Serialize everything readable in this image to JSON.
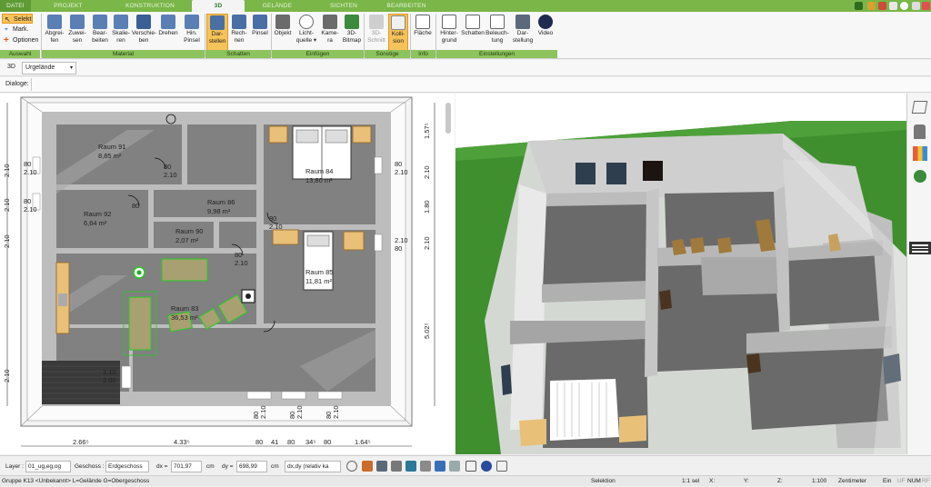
{
  "tabs": [
    "DATEI",
    "PROJEKT",
    "KONSTRUKTION",
    "3D",
    "GELÄNDE",
    "SICHTEN",
    "BEARBEITEN"
  ],
  "active_tab": "3D",
  "ribbon": {
    "auswahl": {
      "selekt": "Selekt",
      "mark": "Mark.",
      "optionen": "Optionen",
      "group": "Auswahl"
    },
    "material": {
      "group": "Material",
      "buttons": [
        {
          "l1": "Abgrei-",
          "l2": "fen"
        },
        {
          "l1": "Zuwei-",
          "l2": "sen"
        },
        {
          "l1": "Bear-",
          "l2": "beiten"
        },
        {
          "l1": "Skalie-",
          "l2": "ren"
        },
        {
          "l1": "Verschie-",
          "l2": "ben"
        },
        {
          "l1": "Drehen",
          "l2": ""
        },
        {
          "l1": "Hin.",
          "l2": "Pinsel"
        }
      ]
    },
    "schatten": {
      "group": "Schatten",
      "buttons": [
        {
          "l1": "Dar-",
          "l2": "stellen"
        },
        {
          "l1": "Rech-",
          "l2": "nen"
        },
        {
          "l1": "Pinsel",
          "l2": ""
        }
      ]
    },
    "einfuegen": {
      "group": "Einfügen",
      "buttons": [
        {
          "l1": "Objekt",
          "l2": ""
        },
        {
          "l1": "Licht-",
          "l2": "quelle ▾"
        },
        {
          "l1": "Kame-",
          "l2": "ra"
        },
        {
          "l1": "3D-",
          "l2": "Bitmap"
        }
      ]
    },
    "sonstige": {
      "group": "Sonstige",
      "buttons": [
        {
          "l1": "3D-",
          "l2": "Schnitt"
        },
        {
          "l1": "Kolli-",
          "l2": "sion"
        }
      ]
    },
    "info": {
      "group": "Info",
      "buttons": [
        {
          "l1": "Fläche",
          "l2": ""
        }
      ]
    },
    "einstellungen": {
      "group": "Einstellungen",
      "buttons": [
        {
          "l1": "Hinter-",
          "l2": "grund"
        },
        {
          "l1": "Schatten",
          "l2": ""
        },
        {
          "l1": "Beleuch-",
          "l2": "tung"
        },
        {
          "l1": "Dar-",
          "l2": "stellung"
        },
        {
          "l1": "Video",
          "l2": ""
        }
      ]
    }
  },
  "toolbar2": {
    "mode": "3D",
    "terrain": "Urgelände"
  },
  "toolbar3": {
    "dialoge": "Dialoge:"
  },
  "floorplan": {
    "rooms": [
      {
        "name": "Raum 91",
        "area": "8,85 m²"
      },
      {
        "name": "Raum 92",
        "area": "6,64 m²"
      },
      {
        "name": "Raum 86",
        "area": "9,98 m²"
      },
      {
        "name": "Raum 90",
        "area": "2,07 m²"
      },
      {
        "name": "Raum 84",
        "area": "13,80 m²"
      },
      {
        "name": "Raum 85",
        "area": "11,81 m²"
      },
      {
        "name": "Raum 83",
        "area": "36,53 m²"
      }
    ],
    "left_dims": [
      "2.10",
      "2.10",
      "2.10",
      "2.10"
    ],
    "right_dims": [
      "1.57⁵",
      "2.10",
      "1.80",
      "2.10",
      "5.02⁵"
    ],
    "opening_labels": [
      "80",
      "2.10",
      "80",
      "2.10",
      "80",
      "2.10",
      "80",
      "2.10",
      "80",
      "2.10",
      "2.00",
      "80",
      "2.10",
      "80",
      "2.10",
      "80",
      "2.10"
    ],
    "bottom_dims": [
      "2.66⁵",
      "4.33⁵",
      "80",
      "41",
      "80",
      "34⁵",
      "80",
      "1.64⁵"
    ],
    "door_labels": [
      "80",
      "2.10",
      "80",
      "2.10",
      "80",
      "2.10"
    ]
  },
  "statusbar": {
    "layer_label": "Layer :",
    "layer_value": "01_ug,eg,og",
    "geschoss_label": "Geschoss :",
    "geschoss_value": "Erdgeschoss",
    "dx_label": "dx =",
    "dx_value": "701,97",
    "dx_unit": "cm",
    "dy_label": "dy =",
    "dy_value": "698,99",
    "dy_unit": "cm",
    "relative": "dx,dy (relativ ka"
  },
  "statusline": {
    "group": "Gruppe K13 <Unbekannt> L=Gelände G=Obergeschoss",
    "mode": "Selektion",
    "scale1": "1:1 sel",
    "x": "X:",
    "y": "Y:",
    "z": "Z:",
    "scale2": "1:100",
    "unit": "Zentimeter",
    "ein": "Ein",
    "uf": "UF",
    "num": "NUM",
    "rf": "RF"
  },
  "colors": {
    "accent_green": "#7ab648",
    "group_bar": "#8dc35c",
    "active_button": "#f6c25a",
    "floor_gray": "#808080",
    "wall_gray": "#c9c9c9",
    "grass": "#3f8f2e"
  },
  "icons": [
    "layers-icon",
    "chair-icon",
    "palette-icon",
    "tree-icon",
    "hamburger-icon"
  ]
}
